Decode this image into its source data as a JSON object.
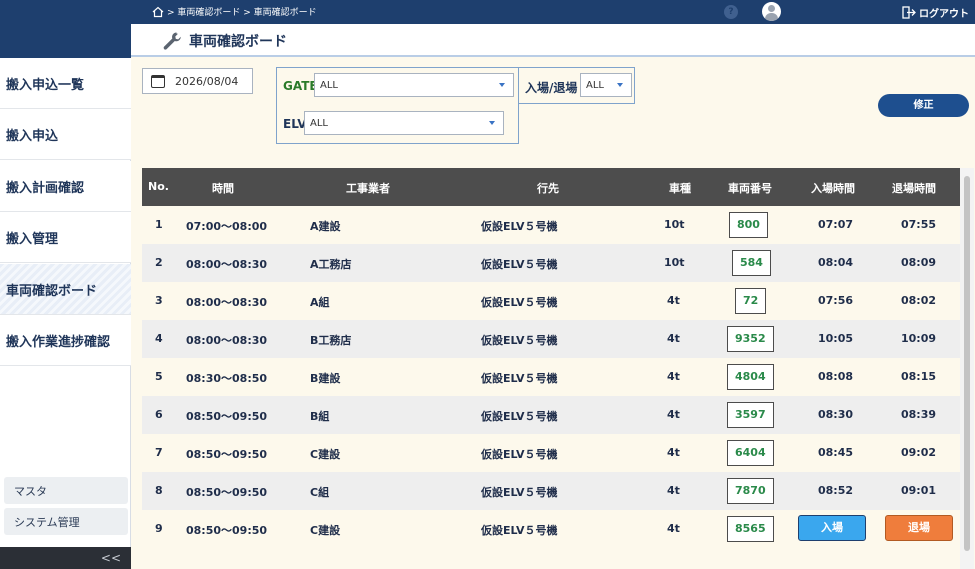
{
  "header": {
    "breadcrumb": "> 車両確認ボード > 車両確認ボード",
    "help": "?",
    "logout_label": "ログアウト"
  },
  "sidebar": {
    "items": [
      {
        "label": "搬入申込一覧"
      },
      {
        "label": "搬入申込"
      },
      {
        "label": "搬入計画確認"
      },
      {
        "label": "搬入管理"
      },
      {
        "label": "車両確認ボード"
      },
      {
        "label": "搬入作業進捗確認"
      }
    ],
    "sub_items": [
      {
        "label": "マスタ"
      },
      {
        "label": "システム管理"
      }
    ],
    "collapse_label": "<<"
  },
  "page": {
    "title": "車両確認ボード",
    "date": "2026/08/04",
    "fix_label": "修正"
  },
  "filters": {
    "gate_label": "GATE",
    "gate_value": "ALL",
    "elv_label": "ELV",
    "elv_value": "ALL",
    "io_label": "入場/退場",
    "io_value": "ALL"
  },
  "table": {
    "headers": {
      "no": "No.",
      "time": "時間",
      "contractor": "工事業者",
      "dest": "行先",
      "vtype": "車種",
      "plate": "車両番号",
      "in": "入場時間",
      "out": "退場時間"
    },
    "rows": [
      {
        "no": "1",
        "time": "07:00～08:00",
        "contractor": "A建設",
        "dest": "仮設ELV５号機",
        "vtype": "10t",
        "plate": "800",
        "in": "07:07",
        "out": "07:55"
      },
      {
        "no": "2",
        "time": "08:00～08:30",
        "contractor": "A工務店",
        "dest": "仮設ELV５号機",
        "vtype": "10t",
        "plate": "584",
        "in": "08:04",
        "out": "08:09"
      },
      {
        "no": "3",
        "time": "08:00～08:30",
        "contractor": "A組",
        "dest": "仮設ELV５号機",
        "vtype": "4t",
        "plate": "72",
        "in": "07:56",
        "out": "08:02"
      },
      {
        "no": "4",
        "time": "08:00～08:30",
        "contractor": "B工務店",
        "dest": "仮設ELV５号機",
        "vtype": "4t",
        "plate": "9352",
        "in": "10:05",
        "out": "10:09"
      },
      {
        "no": "5",
        "time": "08:30～08:50",
        "contractor": "B建設",
        "dest": "仮設ELV５号機",
        "vtype": "4t",
        "plate": "4804",
        "in": "08:08",
        "out": "08:15"
      },
      {
        "no": "6",
        "time": "08:50～09:50",
        "contractor": "B組",
        "dest": "仮設ELV５号機",
        "vtype": "4t",
        "plate": "3597",
        "in": "08:30",
        "out": "08:39"
      },
      {
        "no": "7",
        "time": "08:50～09:50",
        "contractor": "C建設",
        "dest": "仮設ELV５号機",
        "vtype": "4t",
        "plate": "6404",
        "in": "08:45",
        "out": "09:02"
      },
      {
        "no": "8",
        "time": "08:50～09:50",
        "contractor": "C組",
        "dest": "仮設ELV５号機",
        "vtype": "4t",
        "plate": "7870",
        "in": "08:52",
        "out": "09:01"
      },
      {
        "no": "9",
        "time": "08:50～09:50",
        "contractor": "C建設",
        "dest": "仮設ELV５号機",
        "vtype": "4t",
        "plate": "8565",
        "enter_label": "入場",
        "exit_label": "退場"
      }
    ]
  },
  "colors": {
    "header_bg": "#1e3f6e",
    "gate_label": "#2a7a2a",
    "plate_text": "#2a8a4a",
    "enter_button": "#3aa7ee",
    "exit_button": "#ef7d3c"
  }
}
